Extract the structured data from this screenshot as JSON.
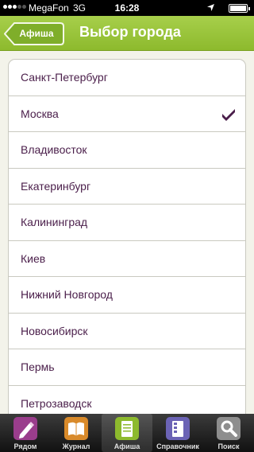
{
  "status_bar": {
    "carrier": "MegaFon",
    "network": "3G",
    "time": "16:28",
    "signal_bars": 3,
    "icons": [
      "signal-icon",
      "location-icon",
      "battery-icon"
    ]
  },
  "nav": {
    "back_label": "Афиша",
    "title": "Выбор города",
    "colors": {
      "bar": "#9cc63b",
      "back_button": "#7fae2a"
    }
  },
  "cities": [
    {
      "name": "Санкт-Петербург",
      "selected": false
    },
    {
      "name": "Москва",
      "selected": true
    },
    {
      "name": "Владивосток",
      "selected": false
    },
    {
      "name": "Екатеринбург",
      "selected": false
    },
    {
      "name": "Калининград",
      "selected": false
    },
    {
      "name": "Киев",
      "selected": false
    },
    {
      "name": "Нижний Новгород",
      "selected": false
    },
    {
      "name": "Новосибирск",
      "selected": false
    },
    {
      "name": "Пермь",
      "selected": false
    },
    {
      "name": "Петрозаводск",
      "selected": false
    }
  ],
  "list_text_color": "#4a1e4a",
  "tabs": [
    {
      "label": "Рядом",
      "icon": "pencil-icon",
      "color": "#9a3d8c",
      "active": false
    },
    {
      "label": "Журнал",
      "icon": "book-icon",
      "color": "#d98a2a",
      "active": false
    },
    {
      "label": "Афиша",
      "icon": "poster-icon",
      "color": "#8dba2d",
      "active": true
    },
    {
      "label": "Справочник",
      "icon": "directory-icon",
      "color": "#6b63b5",
      "active": false
    },
    {
      "label": "Поиск",
      "icon": "search-icon",
      "color": "#8e8e8e",
      "active": false
    }
  ]
}
